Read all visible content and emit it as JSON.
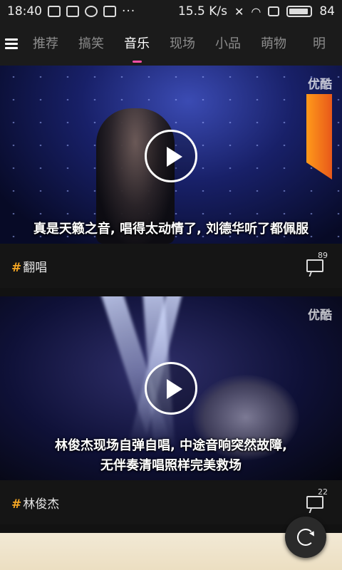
{
  "status_bar": {
    "time": "18:40",
    "network_speed": "15.5 K/s",
    "battery": "84",
    "dots": "···"
  },
  "tabs": [
    {
      "label": "推荐",
      "active": false
    },
    {
      "label": "搞笑",
      "active": false
    },
    {
      "label": "音乐",
      "active": true
    },
    {
      "label": "现场",
      "active": false
    },
    {
      "label": "小品",
      "active": false
    },
    {
      "label": "萌物",
      "active": false
    },
    {
      "label": "明",
      "active": false
    }
  ],
  "feed": [
    {
      "watermark": "优酷",
      "title": "真是天籁之音, 唱得太动情了, 刘德华听了都佩服",
      "tag": "翻唱",
      "comment_count": "89"
    },
    {
      "watermark": "优酷",
      "title_line1": "林俊杰现场自弹自唱, 中途音响突然故障,",
      "title_line2": "无伴奏清唱照样完美救场",
      "tag": "林俊杰",
      "comment_count": "22"
    }
  ],
  "colors": {
    "active_indicator": "#ff4fa6",
    "tag_hash": "#f5a623"
  }
}
